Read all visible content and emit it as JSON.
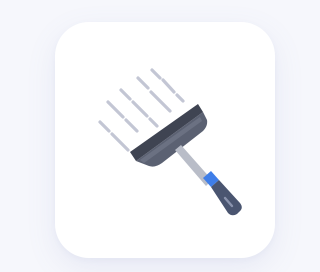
{
  "app_icon": {
    "name": "squeegee-cleaner-icon",
    "colors": {
      "background": "#f6f7fc",
      "tile": "#ffffff",
      "blade_dark": "#4b5060",
      "blade_light": "#6a7080",
      "handle_shaft": "#b9bdc8",
      "handle_grip": "#4a5570",
      "handle_band": "#3f7ee8",
      "spray_lines": "#c3c6d4"
    }
  }
}
